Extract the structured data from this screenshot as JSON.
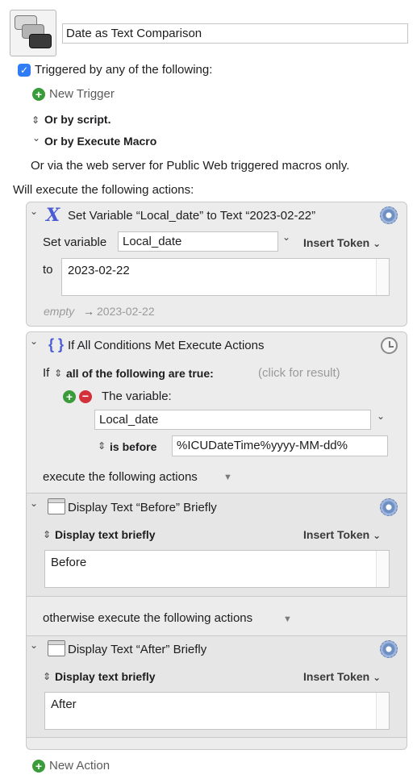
{
  "macro": {
    "name": "Date as Text Comparison",
    "trigger_header": "Triggered by any of the following:",
    "new_trigger": "New Trigger",
    "or_by_script": "Or by script.",
    "or_by_execute_macro": "Or by Execute Macro",
    "web_note": "Or via the web server for Public Web triggered macros only.",
    "will_execute": "Will execute the following actions:",
    "new_action": "New Action"
  },
  "set_variable": {
    "title": "Set Variable “Local_date” to Text “2023-02-22”",
    "set_variable_label": "Set variable",
    "variable_name": "Local_date",
    "insert_token": "Insert Token",
    "to_label": "to",
    "to_value": "2023-02-22",
    "preview_empty": "empty",
    "preview_arrow": "→",
    "preview_value": "2023-02-22"
  },
  "if_action": {
    "title": "If All Conditions Met Execute Actions",
    "if_label": "If",
    "condition_mode": "all of the following are true:",
    "click_result": "(click for result)",
    "the_variable": "The variable:",
    "variable_name": "Local_date",
    "operator": "is before",
    "compare_value": "%ICUDateTime%yyyy-MM-dd%",
    "execute_label": "execute the following actions",
    "otherwise_label": "otherwise execute the following actions"
  },
  "display_before": {
    "title": "Display Text “Before” Briefly",
    "mode": "Display text briefly",
    "insert_token": "Insert Token",
    "text": "Before"
  },
  "display_after": {
    "title": "Display Text “After” Briefly",
    "mode": "Display text briefly",
    "insert_token": "Insert Token",
    "text": "After"
  },
  "glyphs": {
    "checkmark": "✓",
    "plus": "+",
    "minus": "−",
    "chev_down": "⌄",
    "updown": "⇕",
    "tri_down": "▼"
  },
  "icons": [
    "macro-stack-icon",
    "checkbox-icon",
    "add-trigger-icon",
    "variable-x-icon",
    "gear-icon",
    "if-braces-icon",
    "clock-icon",
    "window-icon",
    "add-condition-icon",
    "remove-condition-icon",
    "add-action-icon"
  ],
  "colors": {
    "accent": "#2f7cf6",
    "add_green": "#3a9b3a",
    "remove_red": "#d3313a",
    "variable_blue": "#4a5bd6"
  }
}
